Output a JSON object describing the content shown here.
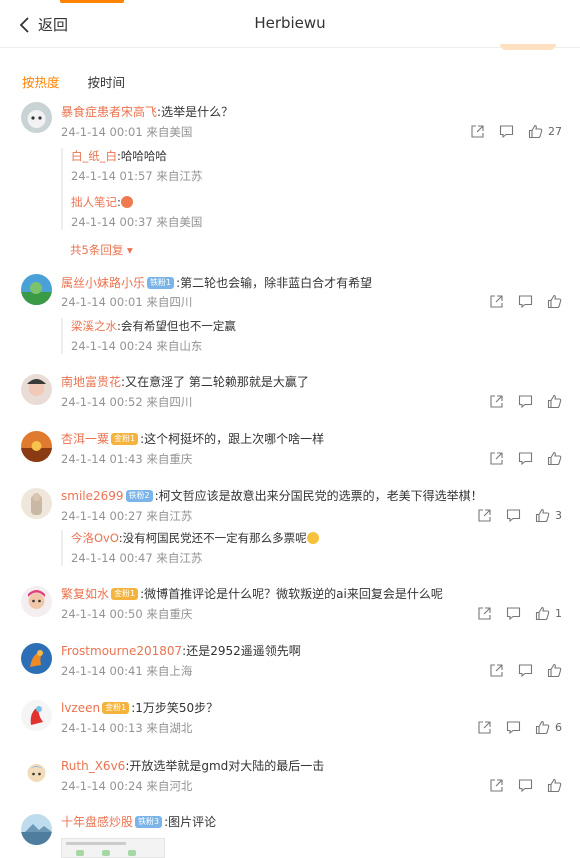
{
  "header": {
    "back_label": "返回",
    "title": "Herbiewu"
  },
  "tabs": [
    {
      "label": "按热度",
      "active": true
    },
    {
      "label": "按时间",
      "active": false
    }
  ],
  "colors": {
    "accent": "#ff8200",
    "username": "#eb7350",
    "meta": "#939393"
  },
  "comments": [
    {
      "user": "暴食症患者宋高飞",
      "badge": "",
      "text": "选举是什么？",
      "meta": "24-1-14 00:01 来自美国",
      "like_count": "27",
      "replies": [
        {
          "user": "白_纸_白",
          "text": "哈哈哈哈",
          "meta": "24-1-14 01:57 来自江苏"
        },
        {
          "user": "拙人笔记",
          "text": "",
          "emoji": "grin-emoji",
          "meta": "24-1-14 00:37 来自美国"
        }
      ],
      "more_replies": "共5条回复"
    },
    {
      "user": "属丝小妹路小乐",
      "badge": "铁粉1",
      "text": "第二轮也会输，除非蓝白合才有希望",
      "meta": "24-1-14 00:01 来自四川",
      "like_count": "",
      "replies": [
        {
          "user": "梁溪之水",
          "text": "会有希望但也不一定赢",
          "meta": "24-1-14 00:24 来自山东"
        }
      ]
    },
    {
      "user": "南地富贵花",
      "badge": "",
      "text": "又在意淫了 第二轮赖那就是大赢了",
      "meta": "24-1-14 00:52 来自四川",
      "like_count": "",
      "replies": []
    },
    {
      "user": "杏洱一粟",
      "badge": "金粉1",
      "text": "这个柯挺坏的，跟上次哪个啥一样",
      "meta": "24-1-14 01:43 来自重庆",
      "like_count": "",
      "replies": []
    },
    {
      "user": "smile2699",
      "badge": "铁粉2",
      "text": "柯文哲应该是故意出来分国民党的选票的，老美下得选举棋！",
      "meta": "24-1-14 00:27 来自江苏",
      "like_count": "3",
      "replies": [
        {
          "user": "今洛OvO",
          "text": "没有柯国民党还不一定有那么多票呢",
          "emoji": "laugh-emoji",
          "meta": "24-1-14 00:47 来自江苏"
        }
      ]
    },
    {
      "user": "繁复如水",
      "badge": "金粉1",
      "text": "微博首推评论是什么呢？微软叛逆的ai来回复会是什么呢",
      "meta": "24-1-14 00:50 来自重庆",
      "like_count": "1",
      "replies": []
    },
    {
      "user": "Frostmourne201807",
      "badge": "",
      "text": "还是2952遥遥领先啊",
      "meta": "24-1-14 00:41 来自上海",
      "like_count": "",
      "replies": []
    },
    {
      "user": "lvzeen",
      "badge": "金粉1",
      "text": "1万步笑50步？",
      "meta": "24-1-14 00:13 来自湖北",
      "like_count": "6",
      "replies": []
    },
    {
      "user": "Ruth_X6v6",
      "badge": "",
      "text": "开放选举就是gmd对大陆的最后一击",
      "meta": "24-1-14 00:24 来自河北",
      "like_count": "",
      "replies": []
    },
    {
      "user": "十年盘感炒股",
      "badge": "铁粉3",
      "text": "图片评论",
      "meta": "",
      "like_count": "",
      "replies": []
    }
  ]
}
